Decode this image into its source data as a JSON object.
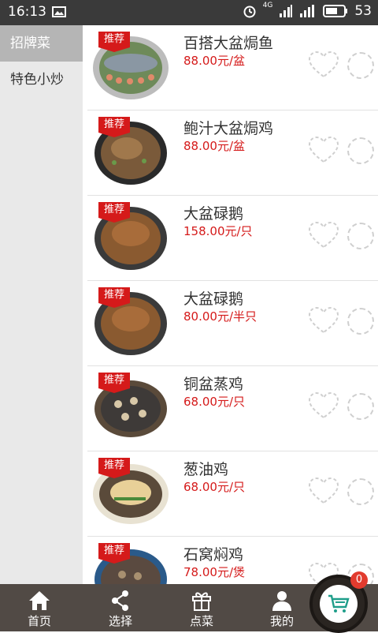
{
  "status_bar": {
    "time": "16:13",
    "network": "4G",
    "battery": "53"
  },
  "sidebar": {
    "categories": [
      {
        "label": "招牌菜",
        "active": true
      },
      {
        "label": "特色小炒",
        "active": false
      }
    ]
  },
  "dishes": [
    {
      "name": "百搭大盆焗鱼",
      "price": "88.00元/盆",
      "badge": "推荐"
    },
    {
      "name": "鲍汁大盆焗鸡",
      "price": "88.00元/盆",
      "badge": "推荐"
    },
    {
      "name": "大盆碌鹅",
      "price": "158.00元/只",
      "badge": "推荐"
    },
    {
      "name": "大盆碌鹅",
      "price": "80.00元/半只",
      "badge": "推荐"
    },
    {
      "name": "铜盆蒸鸡",
      "price": "68.00元/只",
      "badge": "推荐"
    },
    {
      "name": "葱油鸡",
      "price": "68.00元/只",
      "badge": "推荐"
    },
    {
      "name": "石窝焖鸡",
      "price": "78.00元/煲",
      "badge": "推荐"
    }
  ],
  "tabs": [
    {
      "label": "首页",
      "icon": "home-icon"
    },
    {
      "label": "选择",
      "icon": "share-icon"
    },
    {
      "label": "点菜",
      "icon": "gift-icon"
    },
    {
      "label": "我的",
      "icon": "user-icon"
    }
  ],
  "cart": {
    "count": "0",
    "icon": "cart-icon"
  },
  "colors": {
    "accent": "#d51a1a",
    "tabbar": "#514a45",
    "sidebar": "#e9e9e9",
    "sidebar_active": "#b5b5b5"
  }
}
